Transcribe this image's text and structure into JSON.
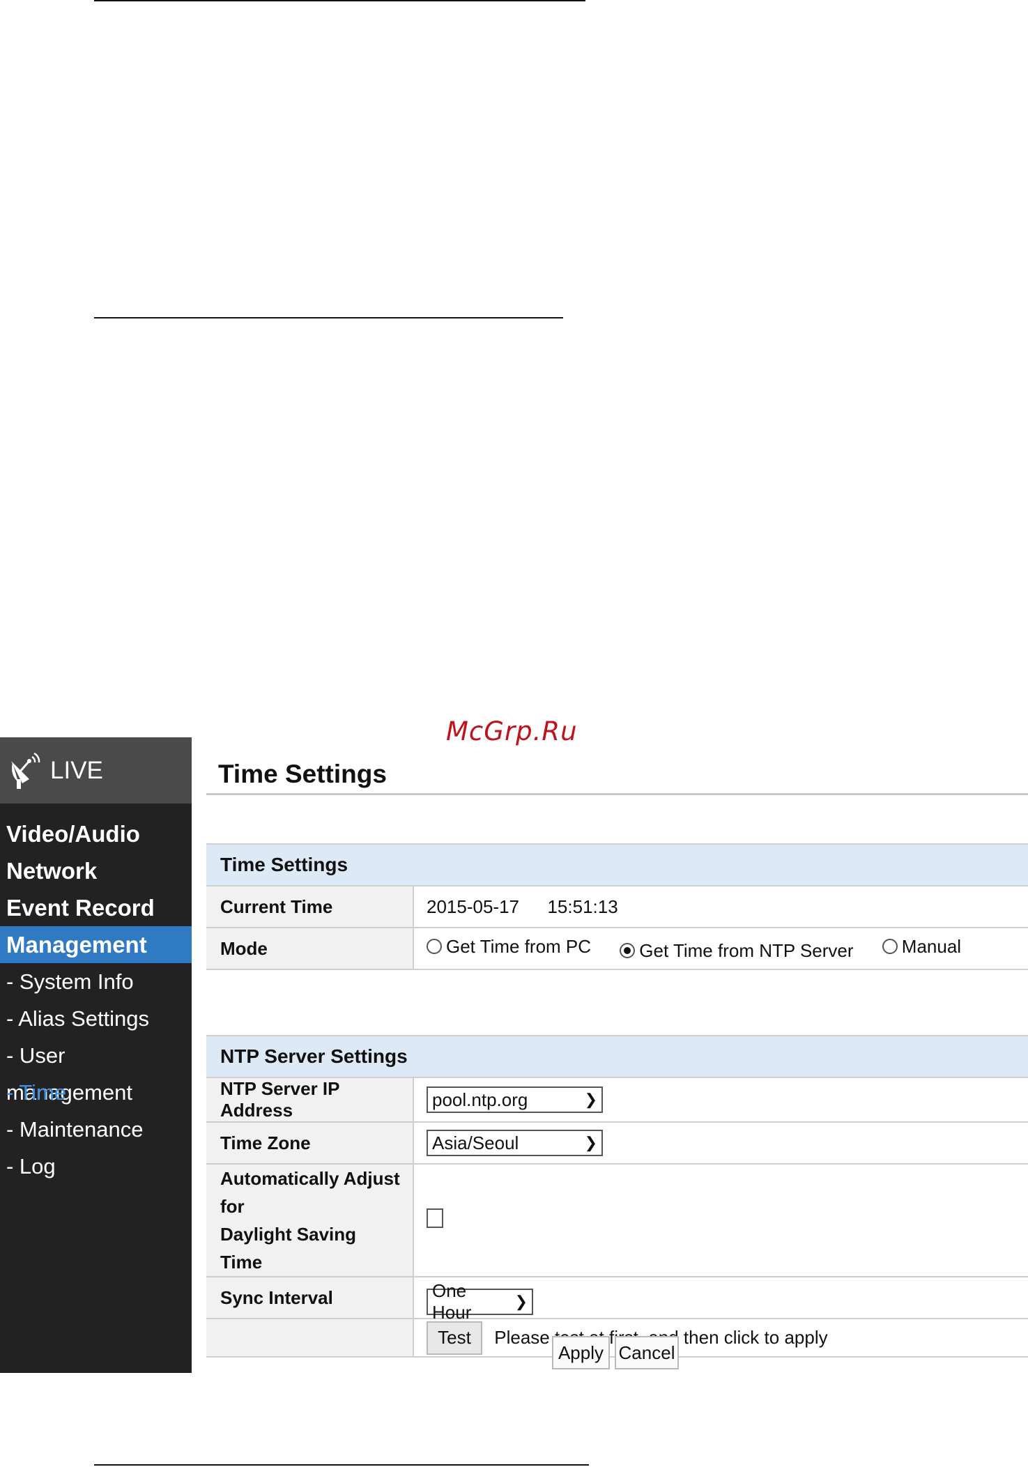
{
  "watermark": "McGrp.Ru",
  "sidebar": {
    "live_label": "LIVE",
    "nav": [
      {
        "label": "Video/Audio"
      },
      {
        "label": "Network"
      },
      {
        "label": "Event Record"
      },
      {
        "label": "Management"
      }
    ],
    "sub": [
      {
        "label": "- System Info"
      },
      {
        "label": "- Alias Settings"
      },
      {
        "label": "- User management"
      },
      {
        "label": "- Time"
      },
      {
        "label": "- Maintenance"
      },
      {
        "label": "- Log"
      }
    ],
    "active_nav": "Management",
    "current_sub": "- Time"
  },
  "page": {
    "title": "Time Settings"
  },
  "time_settings": {
    "header": "Time Settings",
    "current_time_label": "Current Time",
    "current_date": "2015-05-17",
    "current_time": "15:51:13",
    "mode_label": "Mode",
    "mode_options": [
      "Get Time from PC",
      "Get Time from NTP Server",
      "Manual"
    ],
    "mode_selected": "Get Time from NTP Server"
  },
  "ntp_settings": {
    "header": "NTP Server Settings",
    "server_label": "NTP Server IP Address",
    "server_value": "pool.ntp.org",
    "timezone_label": "Time Zone",
    "timezone_value": "Asia/Seoul",
    "dst_label_1": "Automatically Adjust for",
    "dst_label_2": "Daylight Saving Time",
    "dst_checked": false,
    "sync_label": "Sync Interval",
    "sync_value": "One Hour",
    "test_label": "Test",
    "test_hint": "Please test at first, and then click to apply"
  },
  "actions": {
    "apply": "Apply",
    "cancel": "Cancel"
  }
}
